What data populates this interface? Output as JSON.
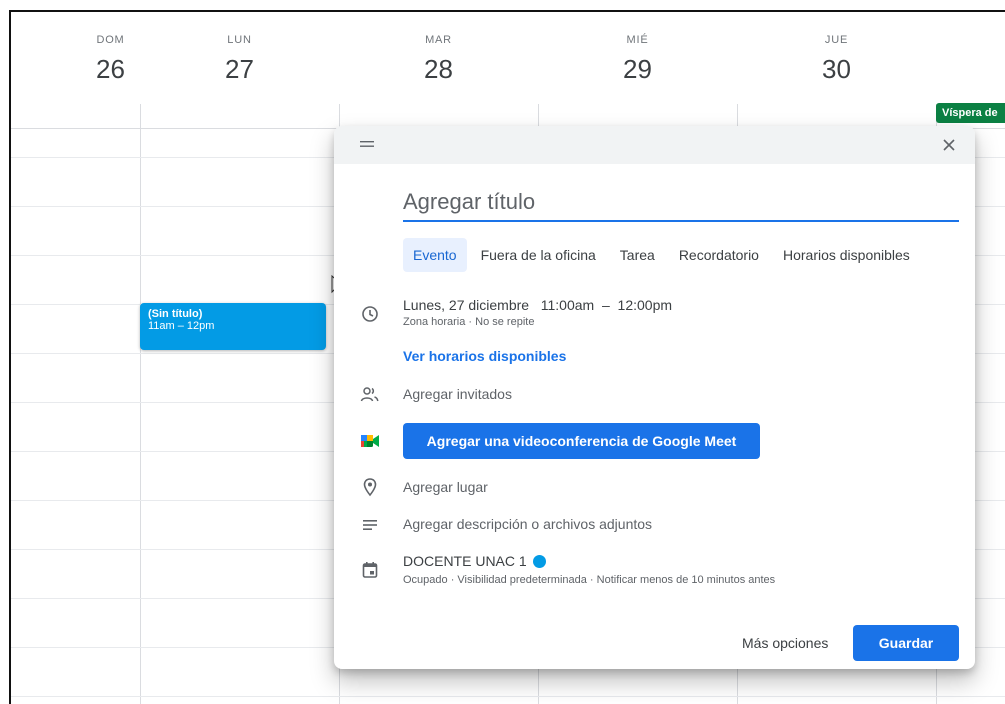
{
  "calendar": {
    "days": [
      {
        "dow": "DOM",
        "num": "26"
      },
      {
        "dow": "LUN",
        "num": "27"
      },
      {
        "dow": "MAR",
        "num": "28"
      },
      {
        "dow": "MIÉ",
        "num": "29"
      },
      {
        "dow": "JUE",
        "num": "30"
      }
    ],
    "allday_chip": "Víspera de",
    "event": {
      "title": "(Sin título)",
      "time": "11am – 12pm"
    }
  },
  "dialog": {
    "title_placeholder": "Agregar título",
    "tabs": [
      {
        "label": "Evento",
        "active": true
      },
      {
        "label": "Fuera de la oficina"
      },
      {
        "label": "Tarea"
      },
      {
        "label": "Recordatorio"
      },
      {
        "label": "Horarios disponibles"
      }
    ],
    "datetime": "Lunes, 27 diciembre   11:00am  –  12:00pm",
    "datetime_sub": "Zona horaria · No se repite",
    "view_availability": "Ver horarios disponibles",
    "add_guests": "Agregar invitados",
    "meet_button": "Agregar una videoconferencia de Google Meet",
    "add_location": "Agregar lugar",
    "add_description": "Agregar descripción o archivos adjuntos",
    "calendar_name": "DOCENTE UNAC 1",
    "calendar_sub": "Ocupado · Visibilidad predeterminada · Notificar menos de 10 minutos antes",
    "more_options": "Más opciones",
    "save": "Guardar"
  },
  "colors": {
    "accent": "#1a73e8",
    "event": "#039be5",
    "holiday": "#0b8043"
  }
}
